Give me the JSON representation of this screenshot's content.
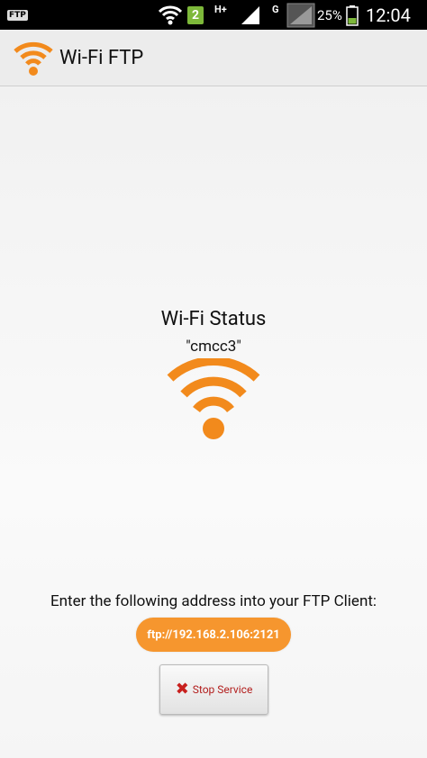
{
  "status_bar": {
    "ftp_badge": "FTP",
    "sim_number": "2",
    "network_type": "H+",
    "network_type_2": "G",
    "battery_percent": "25%",
    "time": "12:04"
  },
  "action_bar": {
    "title": "Wi-Fi FTP",
    "logo_icon": "wifi-icon"
  },
  "main": {
    "status_title": "Wi-Fi Status",
    "ssid": "\"cmcc3\"",
    "status_icon": "wifi-icon",
    "instruction": "Enter the following address into your FTP Client:",
    "ftp_address": "ftp://192.168.2.106:2121",
    "stop_button_label": "Stop Service",
    "stop_icon": "close-icon"
  },
  "colors": {
    "accent": "#f6962e",
    "wifi_orange": "#f28a1c",
    "stop_red": "#c8201e"
  }
}
